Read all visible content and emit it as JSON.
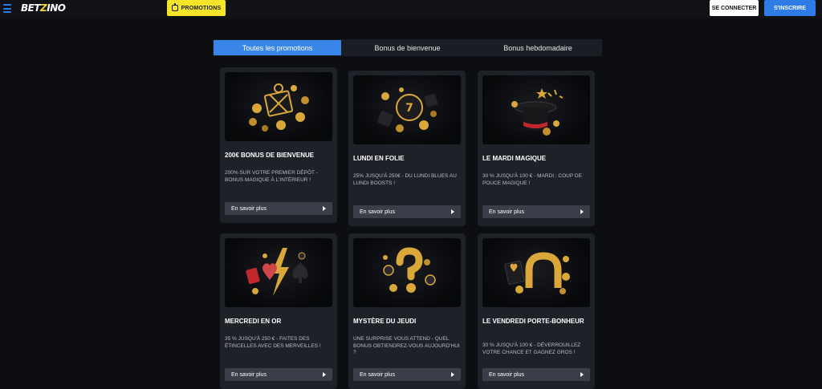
{
  "header": {
    "logo_prefix": "BET",
    "logo_accent": "Z",
    "logo_suffix": "INO",
    "promotions_label": "PROMOTIONS",
    "login_label": "SE CONNECTER",
    "signup_label": "S'INSCRIRE"
  },
  "tabs": [
    {
      "label": "Toutes les promotions",
      "active": true
    },
    {
      "label": "Bonus de bienvenue",
      "active": false
    },
    {
      "label": "Bonus hebdomadaire",
      "active": false
    }
  ],
  "cards": [
    {
      "title": "200€ BONUS DE BIENVENUE",
      "desc": "200% SUR VOTRE PREMIER DÉPÔT - BONUS MAGIQUE À L'INTÉRIEUR !",
      "button": "En savoir plus",
      "icon": "gift-box-coins-icon"
    },
    {
      "title": "LUNDI EN FOLIE",
      "desc": "25% JUSQU'À 250€ - DU LUNDI BLUES AU LUNDI BOOSTS !",
      "button": "En savoir plus",
      "icon": "dice-coins-icon"
    },
    {
      "title": "LE MARDI MAGIQUE",
      "desc": "30 % JUSQU'À 100 € - MARDI : COUP DE POUCE MAGIQUE !",
      "button": "En savoir plus",
      "icon": "magic-hat-icon"
    },
    {
      "title": "MERCREDI EN OR",
      "desc": "35 % JUSQU'À 250 € - FAITES DES ÉTINCELLES AVEC DES MERVEILLES !",
      "button": "En savoir plus",
      "icon": "card-suits-lightning-icon"
    },
    {
      "title": "MYSTÈRE DU JEUDI",
      "desc": "UNE SURPRISE VOUS ATTEND - QUEL BONUS OBTIENDREZ-VOUS AUJOURD'HUI ?",
      "button": "En savoir plus",
      "icon": "question-mark-coins-icon"
    },
    {
      "title": "LE VENDREDI PORTE-BONHEUR",
      "desc": "30 % JUSQU'À 100 € - DÉVERROUILLEZ VOTRE CHANCE ET GAGNEZ GROS !",
      "button": "En savoir plus",
      "icon": "horseshoe-coins-icon"
    }
  ],
  "colors": {
    "accent_yellow": "#f5e52a",
    "accent_blue": "#2f7be8",
    "gold": "#d9a73a",
    "background": "#0d0e12",
    "card": "#1f2128"
  }
}
